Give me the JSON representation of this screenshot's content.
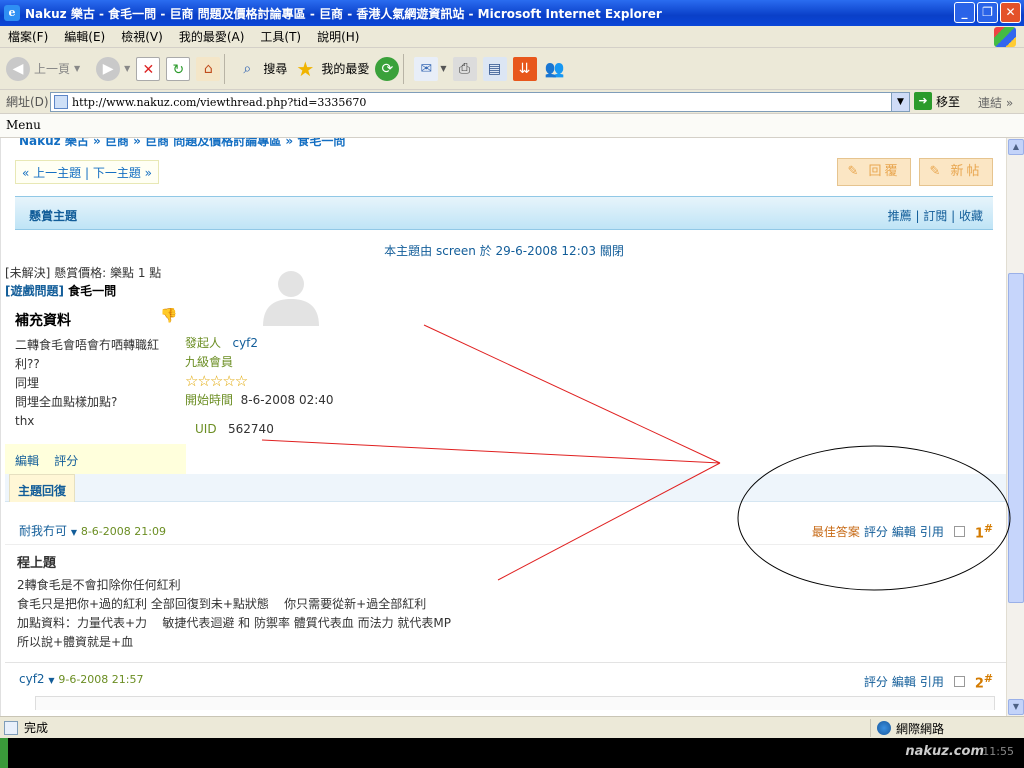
{
  "window": {
    "title": "Nakuz 樂古 - 食毛一問 - 巨商 問題及價格討論專區 - 巨商 - 香港人氣網遊資訊站 - Microsoft Internet Explorer"
  },
  "menubar": [
    "檔案(F)",
    "編輯(E)",
    "檢視(V)",
    "我的最愛(A)",
    "工具(T)",
    "說明(H)"
  ],
  "toolbar": {
    "back": "上一頁",
    "search": "搜尋",
    "favorites": "我的最愛"
  },
  "address": {
    "label": "網址(D)",
    "url": "http://www.nakuz.com/viewthread.php?tid=3335670",
    "go": "移至",
    "links": "連結"
  },
  "menu_label": "Menu",
  "page": {
    "breadcrumb": "Nakuz 樂古 » 巨商 » 巨商 問題及價格討論專區 » 食毛一問",
    "pager": "« 上一主題 | 下一主題 »",
    "reply_btn": "回覆",
    "new_btn": "新帖",
    "thread_type": "懸賞主題",
    "thread_links": "推薦 | 訂閱 | 收藏",
    "closed_msg": "本主題由 screen 於 29-6-2008 12:03 關閉",
    "bounty": "[未解決] 懸賞價格: 樂點 1 點",
    "subject_cat": "[遊戲問題]",
    "subject": " 食毛一問",
    "supplement_title": "補充資料",
    "supplement_lines": [
      "二轉食毛會唔會冇哂轉職紅",
      "利??",
      "同埋",
      "問埋全血點樣加點?",
      "thx"
    ],
    "edit": "編輯",
    "rate": "評分",
    "poster_label": "發起人",
    "poster": "cyf2",
    "rank": "九級會員",
    "stars": "☆☆☆☆☆",
    "start_label": "開始時間",
    "start_time": "8-6-2008 02:40",
    "uid_label": "UID",
    "uid": "562740",
    "reply_tab": "主題回復"
  },
  "posts": [
    {
      "author": "耐我冇可",
      "date": "8-6-2008 21:09",
      "actions": [
        "最佳答案",
        "評分",
        "編輯",
        "引用"
      ],
      "num": "1",
      "title": "程上題",
      "lines": [
        "2轉食毛是不會扣除你任何紅利",
        "食毛只是把你+過的紅利 全部回復到未+點狀態    你只需要從新+過全部紅利",
        "加點資料：力量代表+力    敏捷代表迴避 和 防禦率 體質代表血 而法力 就代表MP",
        "所以說+體資就是+血"
      ]
    },
    {
      "author": "cyf2",
      "date": "9-6-2008 21:57",
      "actions": [
        "評分",
        "編輯",
        "引用"
      ],
      "num": "2"
    }
  ],
  "status": {
    "text": "完成",
    "zone": "網際網路"
  },
  "taskbar": {
    "watermark": "nakuz.com",
    "clock": "11:55"
  }
}
